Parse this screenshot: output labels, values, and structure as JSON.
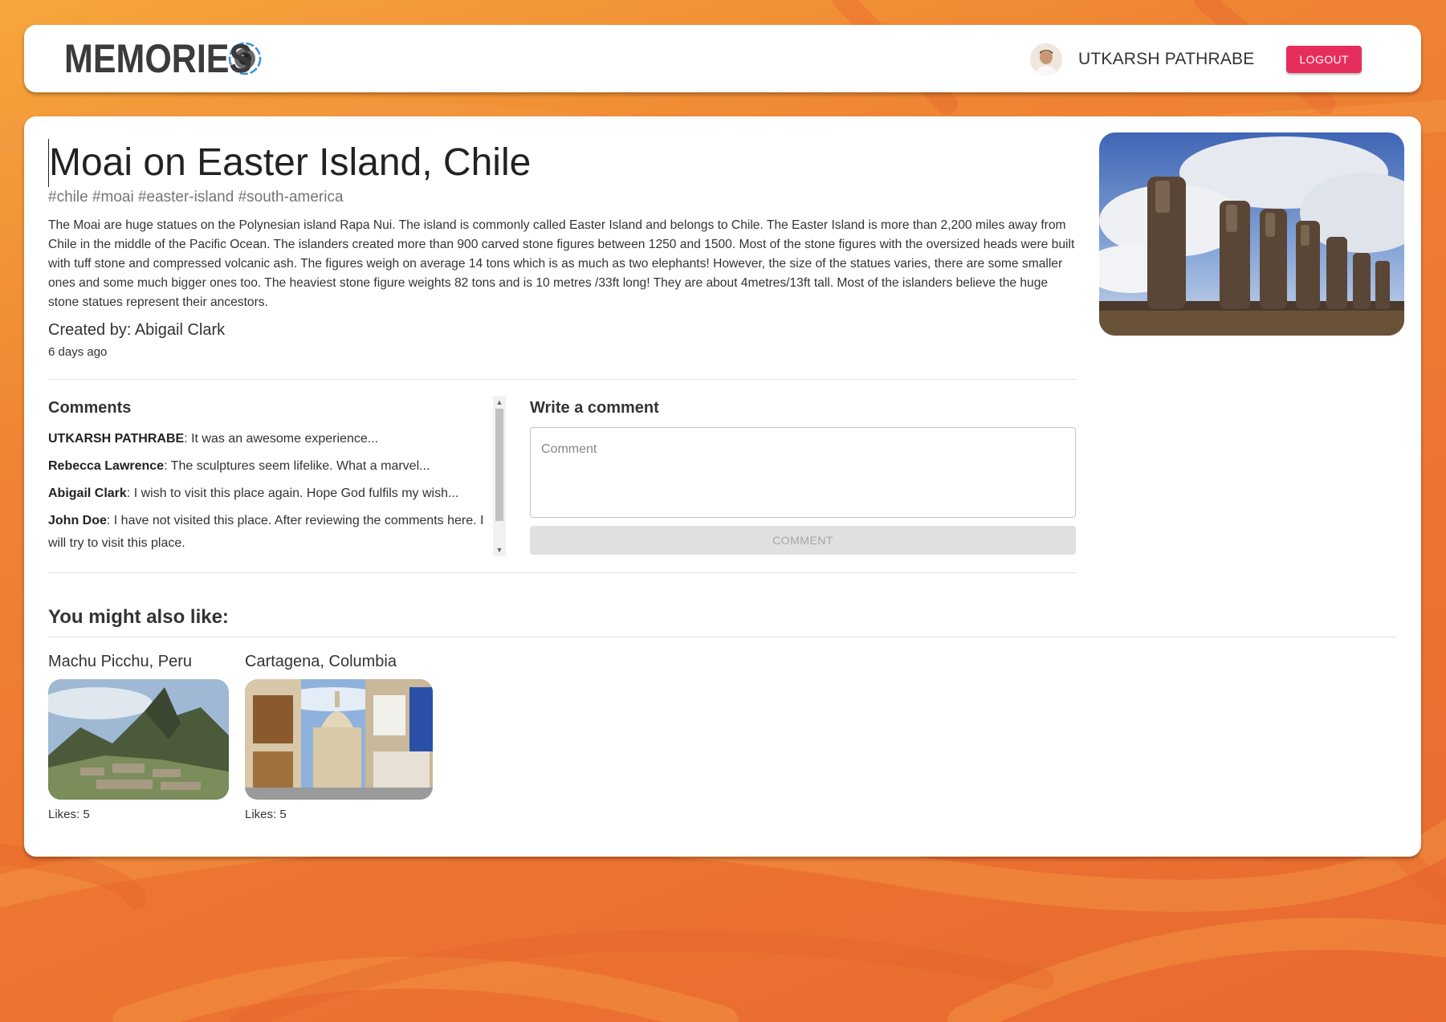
{
  "app": {
    "brand": "MEMORIES"
  },
  "user": {
    "name": "UTKARSH PATHRABE",
    "logout_label": "LOGOUT"
  },
  "post": {
    "title": "Moai on Easter Island, Chile",
    "tags": "#chile #moai #easter-island #south-america",
    "description": "The Moai are huge statues on the Polynesian island Rapa Nui. The island is commonly called Easter Island and belongs to Chile. The Easter Island is more than 2,200 miles away from Chile in the middle of the Pacific Ocean. The islanders created more than 900 carved stone figures between 1250 and 1500. Most of the stone figures with the oversized heads were built with tuff stone and compressed volcanic ash. The figures weigh on average 14 tons which is as much as two elephants! However, the size of the statues varies, there are some smaller ones and some much bigger ones too. The heaviest stone figure weights 82 tons and is 10 metres /33ft long! They are about 4metres/13ft tall. Most of the islanders believe the huge stone statues represent their ancestors.",
    "created_by": "Created by: Abigail Clark",
    "time_ago": "6 days ago"
  },
  "comments": {
    "title": "Comments",
    "items": [
      {
        "author": "UTKARSH PATHRABE",
        "text": ": It was an awesome experience..."
      },
      {
        "author": "Rebecca Lawrence",
        "text": ": The sculptures seem lifelike. What a marvel..."
      },
      {
        "author": "Abigail Clark",
        "text": ": I wish to visit this place again. Hope God fulfils my wish..."
      },
      {
        "author": "John Doe",
        "text": ": I have not visited this place. After reviewing the comments here. I will try to visit this place."
      }
    ]
  },
  "write_comment": {
    "title": "Write a comment",
    "placeholder": "Comment",
    "button_label": "COMMENT"
  },
  "recommended": {
    "title": "You might also like:",
    "items": [
      {
        "title": "Machu Picchu, Peru",
        "likes": "Likes: 5"
      },
      {
        "title": "Cartagena, Columbia",
        "likes": "Likes: 5"
      }
    ]
  },
  "colors": {
    "logout_button": "#e62e5c",
    "background": "#ef8433"
  }
}
